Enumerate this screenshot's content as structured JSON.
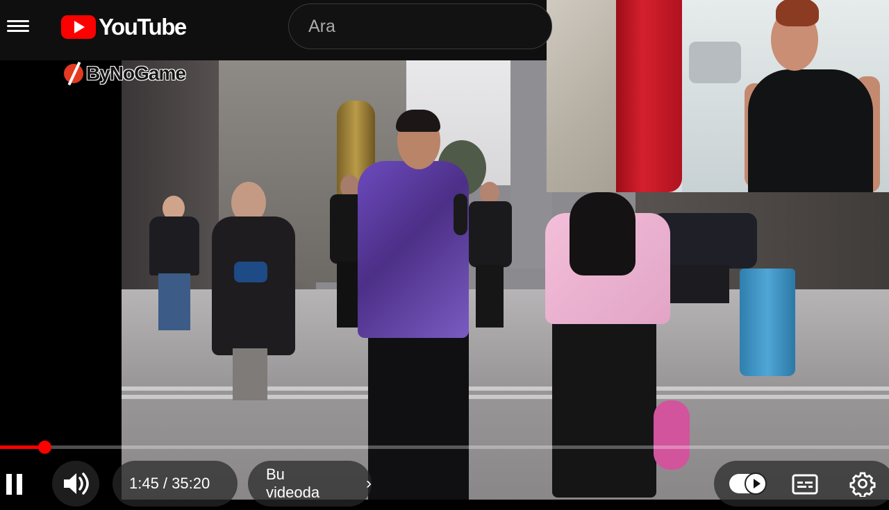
{
  "topbar": {
    "menu_icon": "hamburger-menu-icon",
    "logo_text": "YouTube",
    "search_placeholder": "Ara"
  },
  "watermark": {
    "text": "ByNoGame"
  },
  "player": {
    "progress_fraction": 0.0497,
    "time": "1:45 / 35:20",
    "chapter_label": "Bu videoda",
    "chapter_chevron": "›",
    "icons": {
      "pause": "pause-icon",
      "volume": "volume-icon",
      "autoplay": "autoplay-toggle-icon",
      "captions": "subtitles-icon",
      "settings": "gear-icon"
    },
    "accent_color": "#ff0000"
  }
}
